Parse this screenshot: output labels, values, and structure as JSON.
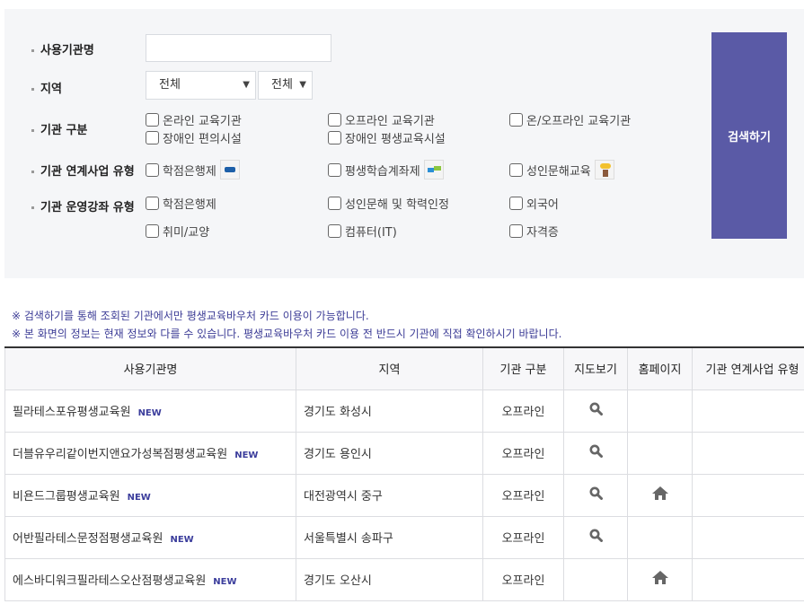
{
  "search": {
    "name_label": "사용기관명",
    "name_value": "",
    "region_label": "지역",
    "region1": "전체",
    "region2": "전체",
    "type_label": "기관 구분",
    "types": [
      "온라인 교육기관",
      "오프라인 교육기관",
      "온/오프라인 교육기관",
      "장애인 편의시설",
      "장애인 평생교육시설"
    ],
    "link_label": "기관 연계사업 유형",
    "links": [
      "학점은행제",
      "평생학습계좌제",
      "성인문해교육"
    ],
    "course_label": "기관 운영강좌 유형",
    "courses": [
      "학점은행제",
      "성인문해 및 학력인정",
      "외국어",
      "취미/교양",
      "컴퓨터(IT)",
      "자격증"
    ],
    "button": "검색하기"
  },
  "notes": [
    "※ 검색하기를 통해 조회된 기관에서만 평생교육바우처 카드 이용이 가능합니다.",
    "※ 본 화면의 정보는 현재 정보와 다를 수 있습니다. 평생교육바우처 카드 이용 전 반드시 기관에 직접 확인하시기 바랍니다."
  ],
  "table": {
    "headers": [
      "사용기관명",
      "지역",
      "기관 구분",
      "지도보기",
      "홈페이지",
      "기관 연계사업 유형"
    ],
    "rows": [
      {
        "name": "필라테스포유평생교육원",
        "badge": "NEW",
        "region": "경기도 화성시",
        "type": "오프라인",
        "map": true,
        "home": false
      },
      {
        "name": "더블유우리같이번지앤요가성복점평생교육원",
        "badge": "NEW",
        "region": "경기도 용인시",
        "type": "오프라인",
        "map": true,
        "home": false
      },
      {
        "name": "비욘드그룹평생교육원",
        "badge": "NEW",
        "region": "대전광역시 중구",
        "type": "오프라인",
        "map": true,
        "home": true
      },
      {
        "name": "어반필라테스문정점평생교육원",
        "badge": "NEW",
        "region": "서울특별시 송파구",
        "type": "오프라인",
        "map": true,
        "home": false
      },
      {
        "name": "에스바디워크필라테스오산점평생교육원",
        "badge": "NEW",
        "region": "경기도 오산시",
        "type": "오프라인",
        "map": false,
        "home": true
      }
    ]
  }
}
